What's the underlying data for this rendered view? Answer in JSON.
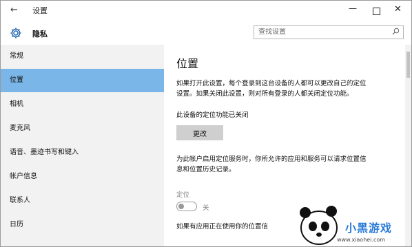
{
  "window": {
    "title": "设置",
    "back_glyph": "←",
    "minimize_glyph": "—",
    "close_glyph": "✕"
  },
  "header": {
    "section_title": "隐私",
    "search_placeholder": "查找设置"
  },
  "sidebar": {
    "items": [
      {
        "label": "常规",
        "active": false
      },
      {
        "label": "位置",
        "active": true
      },
      {
        "label": "相机",
        "active": false
      },
      {
        "label": "麦克风",
        "active": false
      },
      {
        "label": "语音、墨迹书写和键入",
        "active": false
      },
      {
        "label": "帐户信息",
        "active": false
      },
      {
        "label": "联系人",
        "active": false
      },
      {
        "label": "日历",
        "active": false
      }
    ]
  },
  "content": {
    "heading": "位置",
    "para1_line1": "如果打开此设置，每个登录到这台设备的人都可以更改自己的定位",
    "para1_line2": "设置。如果关闭此设置，则对所有登录的人都关闭定位功能。",
    "status": "此设备的定位功能已关闭",
    "change_button": "更改",
    "para2_line1": "为此帐户启用定位服务时，你所允许的应用和服务可以请求位置信",
    "para2_line2": "息和位置历史记录。",
    "location_label": "定位",
    "toggle_state": "关",
    "toggle_on": false,
    "para3_line1": "如果有应用正在使用你的位置信"
  },
  "watermark": {
    "text": "小黑游戏",
    "url": "www.xiaohei.com"
  },
  "colors": {
    "accent": "#7ab6e8",
    "sidebar_bg": "#f2f2f2",
    "button_bg": "#cfcfcf",
    "watermark_blue": "#2a7bd8"
  }
}
